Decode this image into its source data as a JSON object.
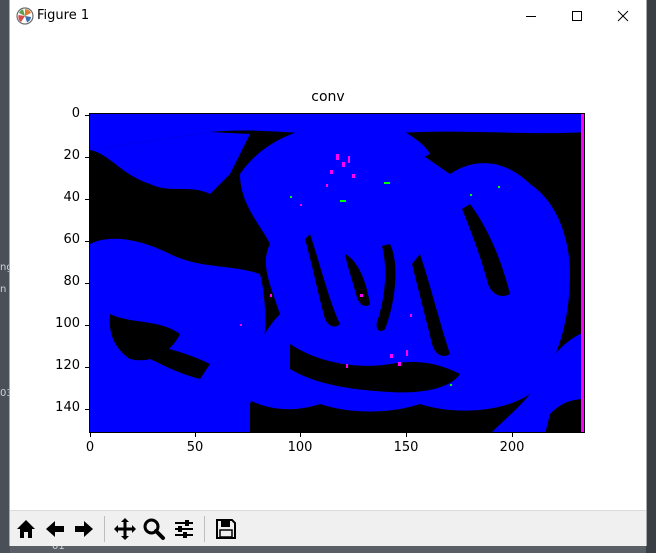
{
  "window": {
    "title": "Figure 1"
  },
  "titlebar": {
    "minimize_label": "—",
    "maximize_label": "☐",
    "close_label": "✕",
    "icons": [
      "matplotlib-icon",
      "minimize-icon",
      "maximize-icon",
      "close-icon"
    ]
  },
  "plot": {
    "title": "conv",
    "x_ticks": [
      "0",
      "50",
      "100",
      "150",
      "200"
    ],
    "y_ticks": [
      "0",
      "20",
      "40",
      "60",
      "80",
      "100",
      "120",
      "140"
    ]
  },
  "chart_data": {
    "type": "heatmap",
    "title": "conv",
    "xlim": [
      0,
      234
    ],
    "ylim": [
      151,
      0
    ],
    "x_ticks": [
      0,
      50,
      100,
      150,
      200
    ],
    "y_ticks": [
      0,
      20,
      40,
      60,
      80,
      100,
      120,
      140
    ],
    "colors": {
      "dominant": "#0000ff",
      "background": "#000000",
      "accent_magenta": "#ff00ff",
      "accent_green": "#00ff00"
    }
  },
  "toolbar": {
    "buttons": [
      "home-icon",
      "back-icon",
      "forward-icon",
      "pan-icon",
      "zoom-icon",
      "configure-icon",
      "save-icon"
    ]
  },
  "background": {
    "left_fragments": [
      "ng",
      "n",
      "03",
      "01"
    ]
  }
}
